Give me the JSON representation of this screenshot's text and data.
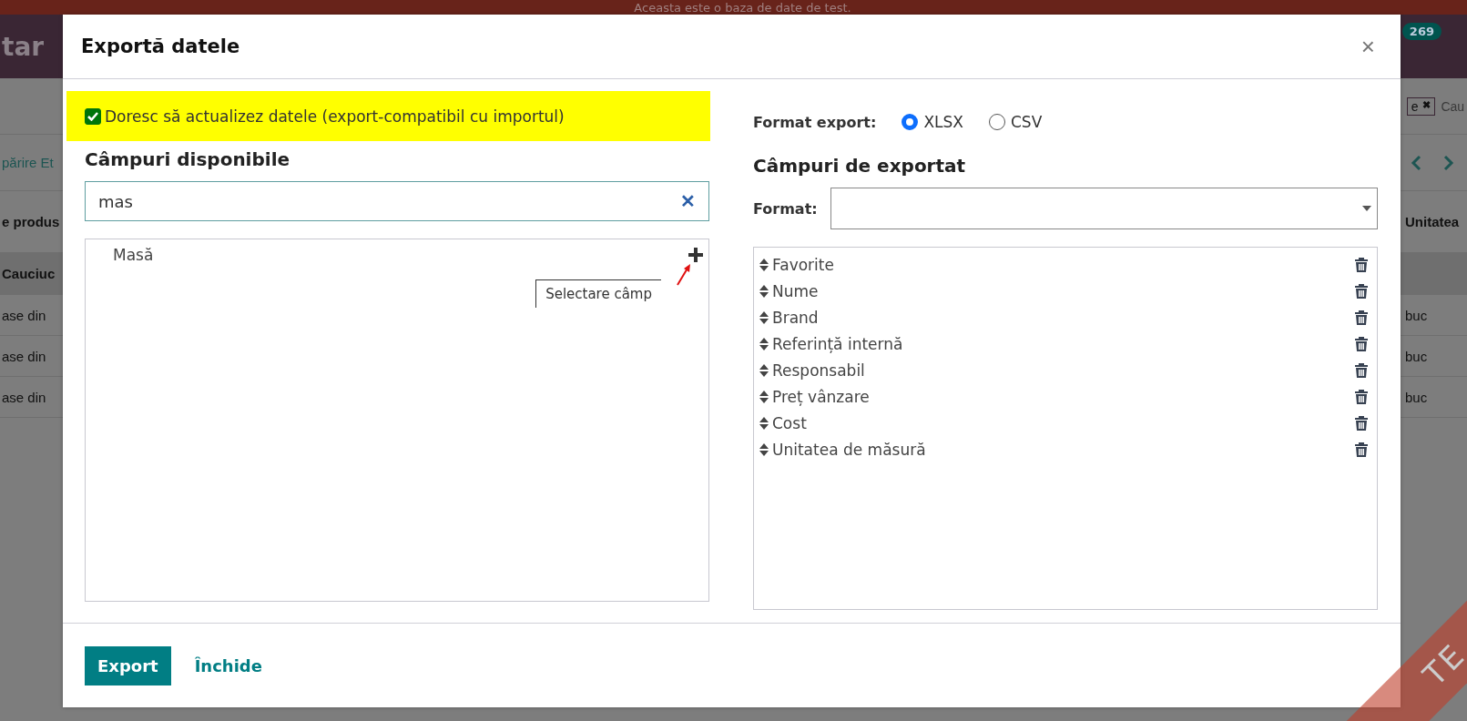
{
  "banner": {
    "text": "Aceasta este o baza de date de test."
  },
  "background": {
    "navbar_title": "tar",
    "badge": "269",
    "facet": {
      "text": "e",
      "remove": "✖"
    },
    "search_placeholder": "Cau",
    "breadcrumb": "părire Et",
    "column_1": "e produs",
    "column_2": "Unitatea",
    "group_row": "Cauciuc",
    "rows": [
      {
        "column_1": "ase din",
        "column_2": "buc"
      },
      {
        "column_1": "ase din",
        "column_2": "buc"
      },
      {
        "column_1": "ase din",
        "column_2": "buc"
      }
    ]
  },
  "ribbon": {
    "text": "TE"
  },
  "dialog": {
    "title": "Exportă datele",
    "close": "×",
    "import_compatible": {
      "label": "Doresc să actualizez datele (export-compatibil cu importul)",
      "checked": true
    },
    "format_export": {
      "label": "Format export:",
      "options": [
        {
          "label": "XLSX",
          "selected": true
        },
        {
          "label": "CSV",
          "selected": false
        }
      ]
    },
    "available": {
      "heading": "Câmpuri disponibile",
      "search_value": "mas",
      "clear": "✕",
      "fields": [
        {
          "label": "Masă"
        }
      ],
      "tooltip": "Selectare câmp"
    },
    "export": {
      "heading": "Câmpuri de exportat",
      "format_label": "Format:",
      "fields": [
        {
          "label": "Favorite"
        },
        {
          "label": "Nume"
        },
        {
          "label": "Brand"
        },
        {
          "label": "Referință internă"
        },
        {
          "label": "Responsabil"
        },
        {
          "label": "Preț vânzare"
        },
        {
          "label": "Cost"
        },
        {
          "label": "Unitatea de măsură"
        }
      ]
    },
    "buttons": [
      {
        "label": "Export",
        "kind": "primary"
      },
      {
        "label": "Închide",
        "kind": "link"
      }
    ]
  }
}
